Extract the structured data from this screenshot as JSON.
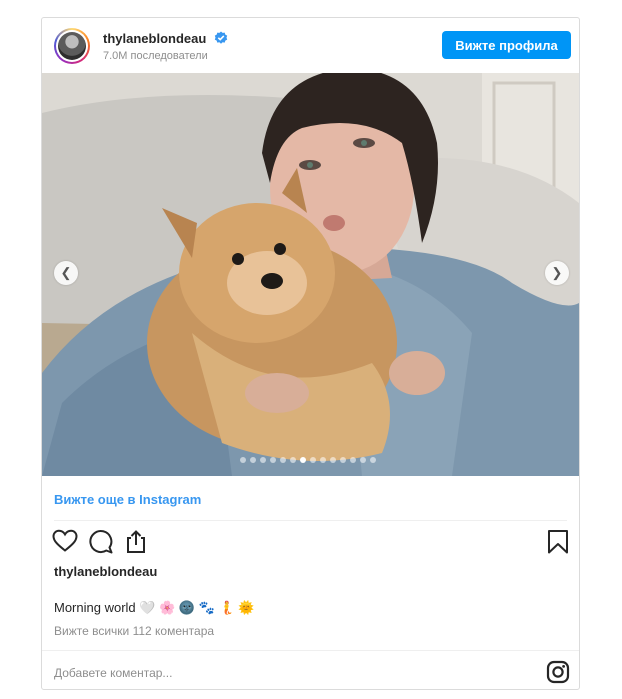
{
  "header": {
    "username": "thylaneblondeau",
    "followers": "7.0M последователи",
    "view_profile_label": "Вижте профила"
  },
  "post": {
    "image_alt": "selfie of a woman with a pomeranian dog",
    "carousel": {
      "dot_count": 14,
      "active_index": 6
    },
    "see_more_label": "Вижте още в Instagram",
    "caption_user": "thylaneblondeau",
    "caption_text": "Morning world 🤍 🌸 🌚 🐾 🧜 🌞",
    "comments_label": "Вижте всички 112 коментара",
    "add_comment_placeholder": "Добавете коментар..."
  },
  "icons": {
    "verified": "verified-badge-icon",
    "prev": "chevron-left-icon",
    "next": "chevron-right-icon",
    "like": "heart-icon",
    "comment": "comment-bubble-icon",
    "share": "share-icon",
    "save": "bookmark-icon",
    "instagram": "instagram-logo-icon"
  },
  "colors": {
    "accent": "#0095f6",
    "link": "#3897f0",
    "muted": "#8e8e8e"
  }
}
